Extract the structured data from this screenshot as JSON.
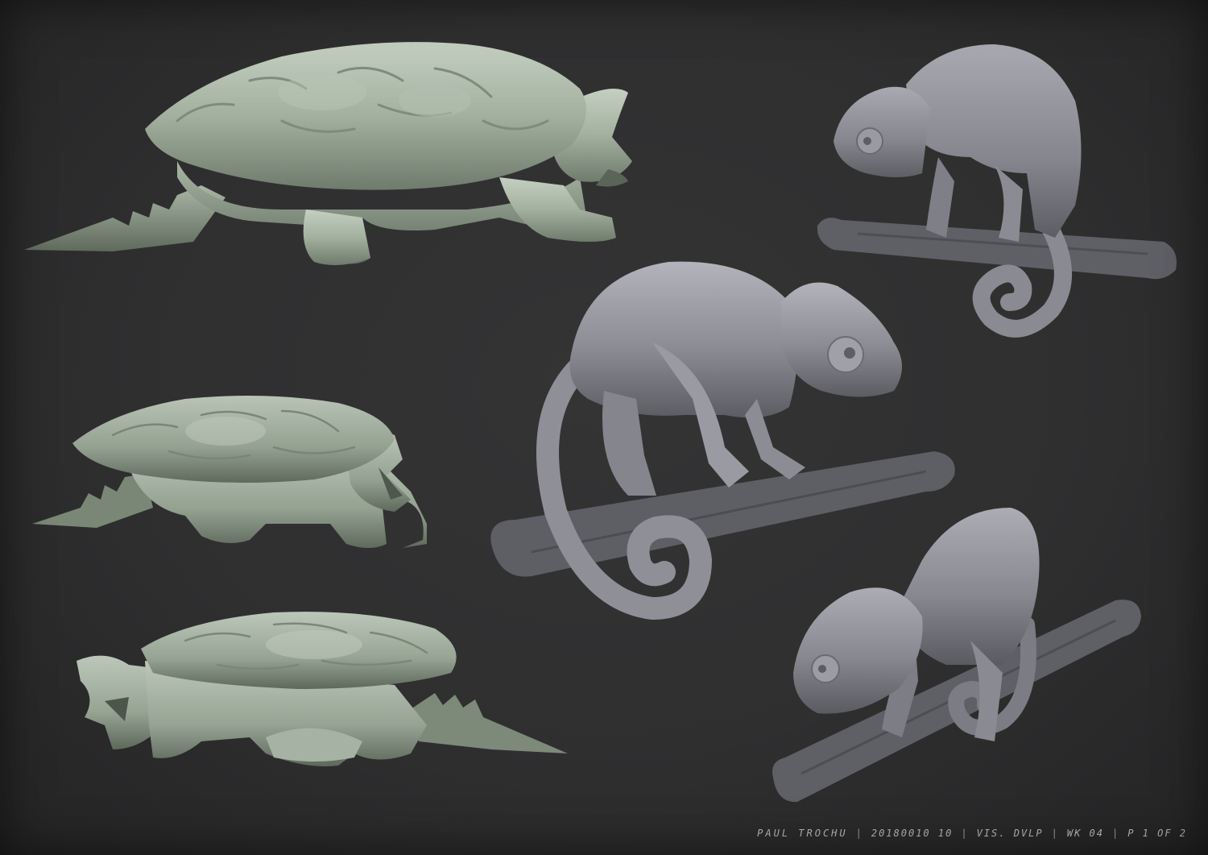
{
  "footer": {
    "artist": "PAUL TROCHU",
    "date": "20180010 10",
    "project": "VIS. DVLP",
    "week": "WK 04",
    "page": "P 1 OF 2"
  },
  "sculptures": {
    "turtle_color": "#a9b5a6",
    "chameleon_color": "#8e8e96",
    "branch_color": "#616167",
    "background_color": "#2e2e2f"
  }
}
